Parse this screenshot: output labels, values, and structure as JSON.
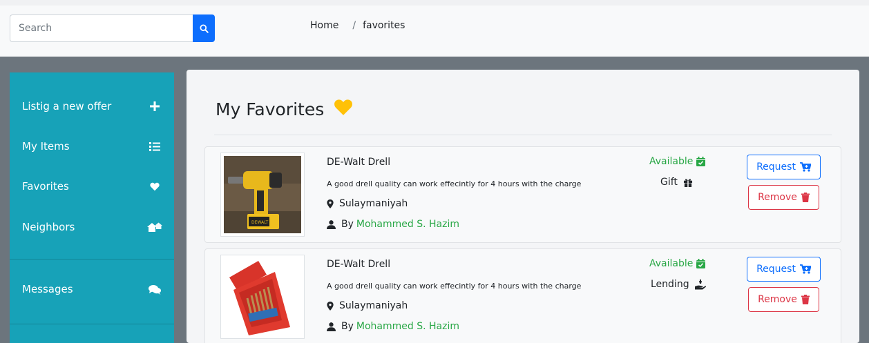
{
  "search": {
    "placeholder": "Search"
  },
  "breadcrumb": {
    "home": "Home",
    "separator": "/",
    "current": "favorites"
  },
  "sidebar": {
    "items": [
      {
        "label": "Listig a new offer",
        "icon": "plus-icon"
      },
      {
        "label": "My Items",
        "icon": "list-icon"
      },
      {
        "label": "Favorites",
        "icon": "heart-icon"
      },
      {
        "label": "Neighbors",
        "icon": "houses-icon"
      },
      {
        "label": "Messages",
        "icon": "comments-icon"
      }
    ]
  },
  "page": {
    "title": "My Favorites",
    "title_icon": "heart-icon"
  },
  "items": [
    {
      "title": "DE-Walt Drell",
      "description": "A good drell quality can work effecintly for 4 hours with the charge",
      "location": "Sulaymaniyah",
      "by_prefix": "By",
      "owner": "Mohammed S. Hazim",
      "status": "Available",
      "type": "Gift",
      "type_icon": "gift-icon",
      "request_label": "Request",
      "remove_label": "Remove"
    },
    {
      "title": "DE-Walt Drell",
      "description": "A good drell quality can work effecintly for 4 hours with the charge",
      "location": "Sulaymaniyah",
      "by_prefix": "By",
      "owner": "Mohammed S. Hazim",
      "status": "Available",
      "type": "Lending",
      "type_icon": "hand-holding-icon",
      "request_label": "Request",
      "remove_label": "Remove"
    }
  ],
  "colors": {
    "sidebar": "#17a2b8",
    "primary": "#0d6efd",
    "success": "#28a745",
    "danger": "#dc3545",
    "heart": "#ffc107"
  }
}
